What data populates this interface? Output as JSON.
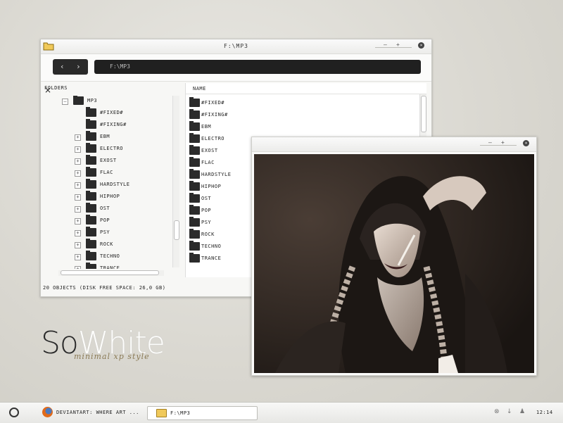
{
  "explorer": {
    "title": "F:\\MP3",
    "address": "F:\\MP3",
    "nav_back": "‹",
    "nav_forward": "›",
    "win_minimize": "–",
    "win_maximize": "+",
    "win_close": "×",
    "folders_label": "FOLDERS",
    "folders_close": "×",
    "tree": [
      {
        "label": "MP3",
        "expander": "–",
        "level": 0
      },
      {
        "label": "#FIXED#",
        "expander": "",
        "level": 1
      },
      {
        "label": "#FIXING#",
        "expander": "",
        "level": 1
      },
      {
        "label": "EBM",
        "expander": "+",
        "level": 1
      },
      {
        "label": "ELECTRO",
        "expander": "+",
        "level": 1
      },
      {
        "label": "EXOST",
        "expander": "+",
        "level": 1
      },
      {
        "label": "FLAC",
        "expander": "+",
        "level": 1
      },
      {
        "label": "HARDSTYLE",
        "expander": "+",
        "level": 1
      },
      {
        "label": "HIPHOP",
        "expander": "+",
        "level": 1
      },
      {
        "label": "OST",
        "expander": "+",
        "level": 1
      },
      {
        "label": "POP",
        "expander": "+",
        "level": 1
      },
      {
        "label": "PSY",
        "expander": "+",
        "level": 1
      },
      {
        "label": "ROCK",
        "expander": "+",
        "level": 1
      },
      {
        "label": "TECHNO",
        "expander": "+",
        "level": 1
      },
      {
        "label": "TRANCE",
        "expander": "+",
        "level": 1
      }
    ],
    "list_header": "NAME",
    "files": [
      "#FIXED#",
      "#FIXING#",
      "EBM",
      "ELECTRO",
      "EXOST",
      "FLAC",
      "HARDSTYLE",
      "HIPHOP",
      "OST",
      "POP",
      "PSY",
      "ROCK",
      "TECHNO",
      "TRANCE"
    ],
    "status": "20 OBJECTS (DISK FREE SPACE: 26,0 GB)"
  },
  "viewer": {
    "win_minimize": "–",
    "win_maximize": "+",
    "win_close": "×"
  },
  "branding": {
    "so": "So",
    "white": "White",
    "tagline": "minimal xp style"
  },
  "taskbar": {
    "firefox_task": "DEVIANTART: WHERE ART ...",
    "explorer_task": "F:\\MP3",
    "clock": "12:14"
  },
  "colors": {
    "accent_dark": "#2b2b2b",
    "tagline": "#8a7a55",
    "folder_yellow": "#f0c95a"
  }
}
